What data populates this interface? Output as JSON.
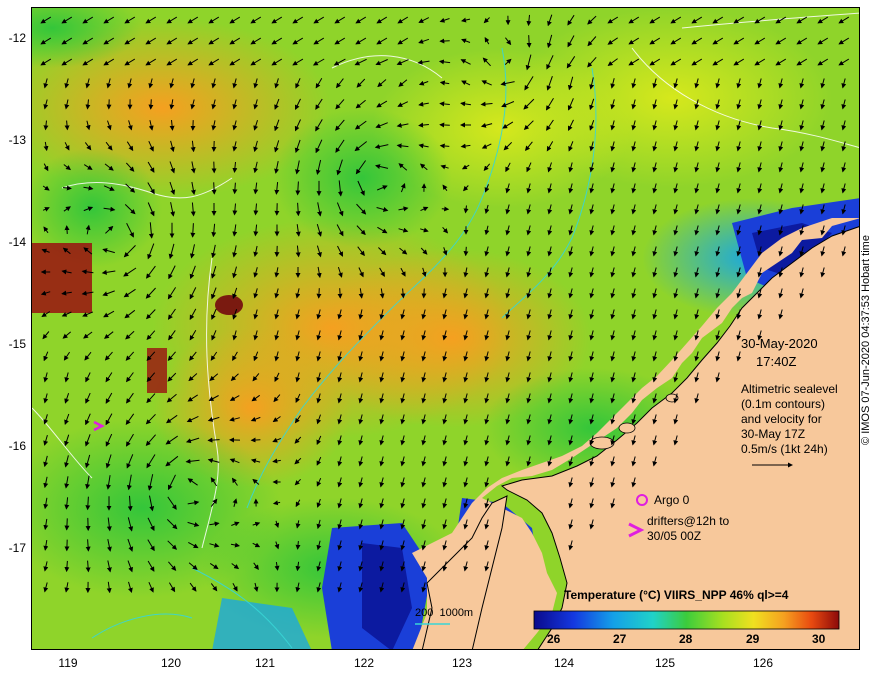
{
  "map": {
    "y_ticks": [
      "-12",
      "-13",
      "-14",
      "-15",
      "-16",
      "-17"
    ],
    "x_ticks": [
      "119",
      "120",
      "121",
      "122",
      "123",
      "124",
      "125",
      "126"
    ],
    "timestamp": {
      "date": "30-May-2020",
      "time": "17:40Z"
    },
    "altimetry_note": {
      "line1": "Altimetric sealevel",
      "line2": "(0.1m contours)",
      "line3": "and velocity for",
      "line4": "30-May 17Z",
      "scale_label": "0.5m/s (1kt 24h)"
    },
    "argo_label": "Argo 0",
    "drifters_label": {
      "line1": "drifters@12h to",
      "line2": "30/05 00Z"
    },
    "bathymetry_label": "200  1000m",
    "colorbar": {
      "title": "Temperature (°C) VIIRS_NPP 46% ql>=4",
      "ticks": [
        "26",
        "27",
        "28",
        "29",
        "30"
      ]
    },
    "credit": "© IMOS 07-Jun-2020 04:37:53 Hobart time",
    "colors": {
      "land": "#f7c89b",
      "coast_line": "#000000",
      "arrow": "#000000",
      "bathymetry": "#38d6d6",
      "argo_marker": "#e01ee0",
      "drifter_marker": "#e01ee0"
    }
  }
}
